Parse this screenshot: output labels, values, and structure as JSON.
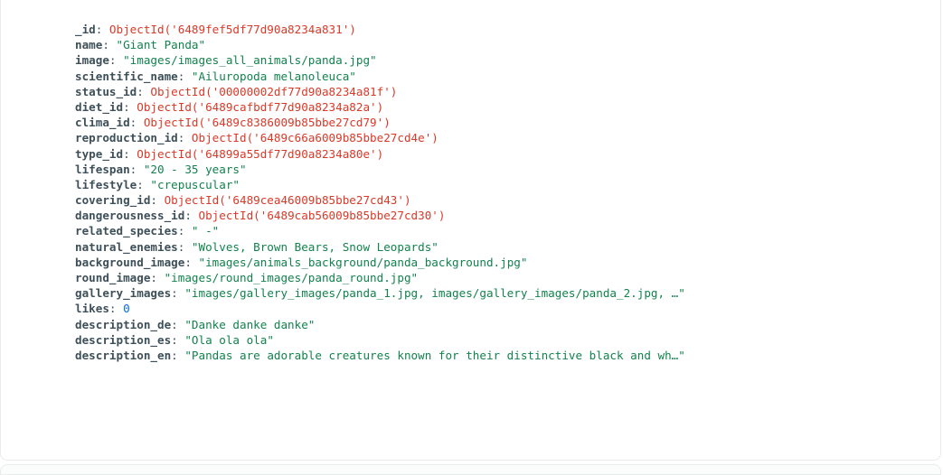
{
  "document": {
    "fields": [
      {
        "key": "_id",
        "value": "ObjectId('6489fef5df77d90a8234a831')",
        "type": "objectid"
      },
      {
        "key": "name",
        "value": "\"Giant Panda\"",
        "type": "string"
      },
      {
        "key": "image",
        "value": "\"images/images_all_animals/panda.jpg\"",
        "type": "string"
      },
      {
        "key": "scientific_name",
        "value": "\"Ailuropoda melanoleuca\"",
        "type": "string"
      },
      {
        "key": "status_id",
        "value": "ObjectId('00000002df77d90a8234a81f')",
        "type": "objectid"
      },
      {
        "key": "diet_id",
        "value": "ObjectId('6489cafbdf77d90a8234a82a')",
        "type": "objectid"
      },
      {
        "key": "clima_id",
        "value": "ObjectId('6489c8386009b85bbe27cd79')",
        "type": "objectid"
      },
      {
        "key": "reproduction_id",
        "value": "ObjectId('6489c66a6009b85bbe27cd4e')",
        "type": "objectid"
      },
      {
        "key": "type_id",
        "value": "ObjectId('64899a55df77d90a8234a80e')",
        "type": "objectid"
      },
      {
        "key": "lifespan",
        "value": "\"20 - 35 years\"",
        "type": "string"
      },
      {
        "key": "lifestyle",
        "value": "\"crepuscular\"",
        "type": "string"
      },
      {
        "key": "covering_id",
        "value": "ObjectId('6489cea46009b85bbe27cd43')",
        "type": "objectid"
      },
      {
        "key": "dangerousness_id",
        "value": "ObjectId('6489cab56009b85bbe27cd30')",
        "type": "objectid"
      },
      {
        "key": "related_species",
        "value": "\"  -\"",
        "type": "string"
      },
      {
        "key": "natural_enemies",
        "value": "\"Wolves, Brown Bears, Snow Leopards\"",
        "type": "string"
      },
      {
        "key": "background_image",
        "value": "\"images/animals_background/panda_background.jpg\"",
        "type": "string"
      },
      {
        "key": "round_image",
        "value": "\"images/round_images/panda_round.jpg\"",
        "type": "string"
      },
      {
        "key": "gallery_images",
        "value": "\"images/gallery_images/panda_1.jpg, images/gallery_images/panda_2.jpg, …\"",
        "type": "string"
      },
      {
        "key": "likes",
        "value": "0",
        "type": "number"
      },
      {
        "key": "description_de",
        "value": "\"Danke danke danke\"",
        "type": "string"
      },
      {
        "key": "description_es",
        "value": "\"Ola ola ola\"",
        "type": "string"
      },
      {
        "key": "description_en",
        "value": "\"Pandas are adorable creatures known for their distinctive black and wh…\"",
        "type": "string"
      }
    ]
  },
  "colors": {
    "key": "#3d4f58",
    "string": "#12824d",
    "objectid": "#db3928",
    "number": "#016bf8",
    "card_border": "#e8edeb"
  }
}
